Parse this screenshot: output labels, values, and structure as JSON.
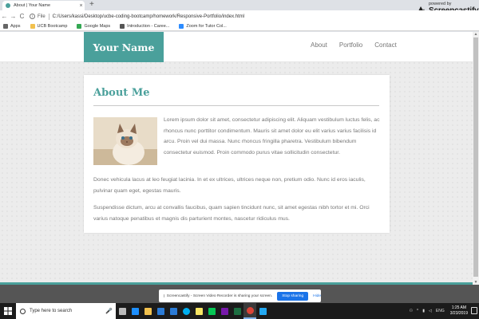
{
  "browser": {
    "tab_title": "About | Your Name",
    "tab_close": "×",
    "new_tab": "+",
    "scheme_label": "File",
    "url": "C:/Users/kassi/Desktop/ucbe-coding-bootcamp/homework/Responsive-Portfolio/index.html",
    "nav_back": "←",
    "nav_forward": "→",
    "nav_reload": "C",
    "bookmarks": [
      {
        "label": "Apps",
        "icon": "apps-grid-icon",
        "color": "#666666"
      },
      {
        "label": "UCB Bootcamp",
        "icon": "folder-icon",
        "color": "#f2c14e"
      },
      {
        "label": "Google Maps",
        "icon": "maps-icon",
        "color": "#34a853"
      },
      {
        "label": "Introduction - Caree...",
        "icon": "page-icon",
        "color": "#555555"
      },
      {
        "label": "Zoom for Tutor Col...",
        "icon": "zoom-icon",
        "color": "#2d8cff"
      }
    ]
  },
  "recorder_logo": {
    "powered": "powered by",
    "name": "Screencastify"
  },
  "site": {
    "brand": "Your Name",
    "nav": [
      "About",
      "Portfolio",
      "Contact"
    ],
    "title": "About Me",
    "paragraphs": [
      "Lorem ipsum dolor sit amet, consectetur adipiscing elit. Aliquam vestibulum luctus felis, ac rhoncus nunc porttitor condimentum. Mauris sit amet dolor eu elit varius varius facilisis id arcu. Proin vel dui massa. Nunc rhoncus fringilla pharetra. Vestibulum bibendum consectetur euismod. Proin commodo purus vitae sollicitudin consectetur.",
      "Donec vehicula lacus at leo feugiat lacinia. In et ex ultrices, ultrices neque non, pretium odio. Nunc id eros iaculis, pulvinar quam eget, egestas mauris.",
      "Suspendisse dictum, arcu at convallis faucibus, quam sapien tincidunt nunc, sit amet egestas nibh tortor et mi. Orci varius natoque penatibus et magnis dis parturient montes, nascetur ridiculus mus."
    ],
    "accent_color": "#4aa09b"
  },
  "sharing_bar": {
    "message": "Screencastify - Screen Video Recorder is sharing your screen.",
    "stop_label": "Stop sharing",
    "hide_label": "Hide"
  },
  "taskbar": {
    "search_placeholder": "Type here to search",
    "pinned": [
      {
        "icon": "task-view-icon",
        "color": "#bbbbbb"
      },
      {
        "icon": "edge-icon",
        "color": "#1e90ff"
      },
      {
        "icon": "file-explorer-icon",
        "color": "#f2c14e"
      },
      {
        "icon": "store-icon",
        "color": "#2b7bd6"
      },
      {
        "icon": "mail-icon",
        "color": "#2b7bd6"
      },
      {
        "icon": "skype-icon",
        "color": "#00aff0"
      },
      {
        "icon": "sticky-notes-icon",
        "color": "#f7e463"
      },
      {
        "icon": "line-icon",
        "color": "#06c755"
      },
      {
        "icon": "onenote-icon",
        "color": "#7719aa"
      },
      {
        "icon": "excel-icon",
        "color": "#1d6f42"
      },
      {
        "icon": "chrome-icon",
        "color": "#db4437"
      },
      {
        "icon": "vscode-icon",
        "color": "#23a9f2"
      }
    ],
    "language": "ENG",
    "time": "1:25 AM",
    "date": "3/23/2019"
  }
}
